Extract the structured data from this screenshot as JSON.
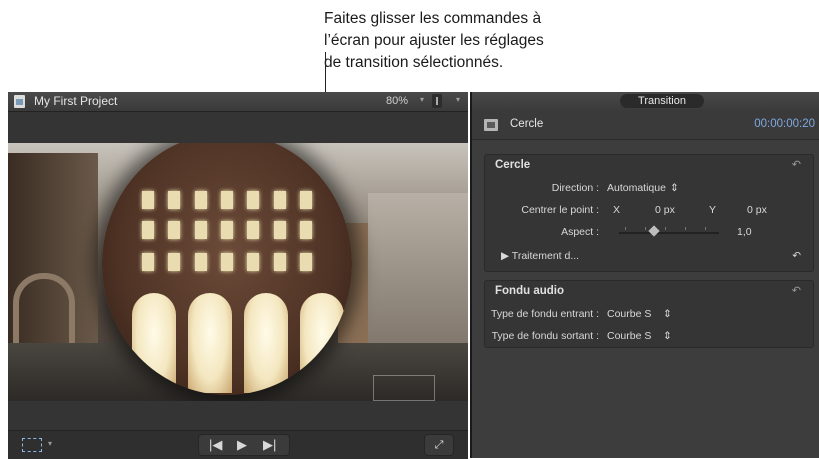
{
  "callout": {
    "lines": [
      "Faites glisser les commandes à",
      "l’écran pour ajuster les réglages",
      "de transition sélectionnés."
    ]
  },
  "viewer": {
    "title": "My First Project",
    "zoom": "80%",
    "zoom_arrow": "▾",
    "transport": {
      "prev": "|◀",
      "play": "▶",
      "next": "▶|"
    },
    "fullscreen": "⤢"
  },
  "inspector": {
    "tab": "Transition",
    "name": "Cercle",
    "timecode": "00:00:00:20",
    "sections": {
      "cercle": {
        "title": "Cercle",
        "reset": "↶",
        "direction_label": "Direction :",
        "direction_value": "Automatique",
        "popup_arrows": "⇕",
        "center_label": "Centrer le point :",
        "x_label": "X",
        "x_value": "0 px",
        "y_label": "Y",
        "y_value": "0 px",
        "aspect_label": "Aspect :",
        "aspect_value": "1,0",
        "aspect_level": 0.35,
        "processing_label": "▶  Traitement d..."
      },
      "audio": {
        "title": "Fondu audio",
        "reset": "↶",
        "fade_in_label": "Type de fondu entrant :",
        "fade_in_value": "Courbe S",
        "fade_out_label": "Type de fondu sortant :",
        "fade_out_value": "Courbe S",
        "popup_arrows": "⇕"
      }
    }
  },
  "colors": {
    "accent_timecode": "#7fa8e0",
    "panel_bg": "#3d3d3d"
  }
}
